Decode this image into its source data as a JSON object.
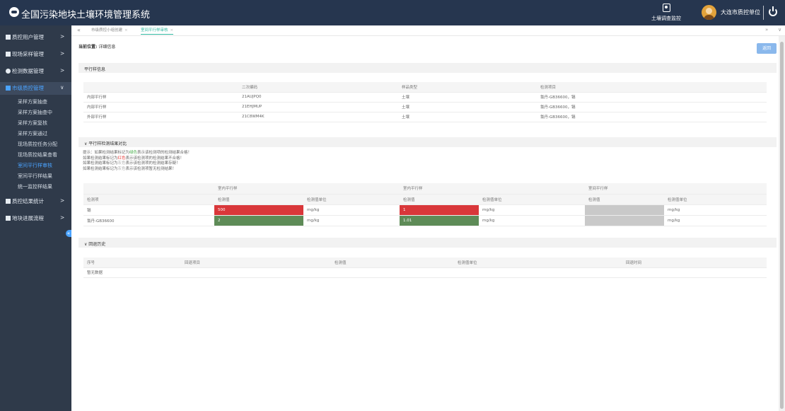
{
  "header": {
    "app_title": "全国污染地块土壤环境管理系统",
    "env_label": "土壤调查监控",
    "user_name": "大连市质控单位"
  },
  "sidebar": {
    "items": [
      {
        "label": "质控用户管理",
        "arrow": ">"
      },
      {
        "label": "现场采样管理",
        "arrow": ">"
      },
      {
        "label": "检测数据管理",
        "arrow": ">"
      },
      {
        "label": "市级质控管理",
        "arrow": "∨"
      },
      {
        "label": "质控结果统计",
        "arrow": ">"
      },
      {
        "label": "地块进展流程",
        "arrow": ">"
      }
    ],
    "sub_items": [
      "采样方案抽查",
      "采样方案抽查中",
      "采样方案复核",
      "采样方案通过",
      "现场质控任务分配",
      "现场质控结果查看",
      "室间平行样审核",
      "室间平行样结果",
      "统一监控样结果"
    ],
    "collapse": "«"
  },
  "tabs": {
    "prev": "«",
    "items": [
      {
        "label": "市级质控小组创建",
        "close": "×"
      },
      {
        "label": "室间平行样审核",
        "close": "×"
      }
    ],
    "next": "»",
    "dropdown": "∨"
  },
  "breadcrumb": {
    "label": "当前位置:",
    "value": "详细信息"
  },
  "back_button": "返回",
  "parallel_info": {
    "title": "平行样信息",
    "headers": [
      "",
      "二次编码",
      "样品类型",
      "检测项目"
    ],
    "rows": [
      [
        "内部平行样",
        "21AUJPQ0",
        "土壤",
        "氯丹-GB36600，镉"
      ],
      [
        "内部平行样",
        "21EHJMUP",
        "土壤",
        "氯丹-GB36600，镉"
      ],
      [
        "外部平行样",
        "21C8WM4K",
        "土壤",
        "氯丹-GB36600，镉"
      ]
    ]
  },
  "comparison": {
    "title": "∨ 平行样检测结果对比",
    "tips": {
      "line1_prefix": "提示：如果检测结果标记为",
      "line1_color": "绿色",
      "line1_suffix": "表示该检测项的检测结果合格！",
      "line2_prefix": "如果检测结果标记为",
      "line2_color": "红色",
      "line2_suffix": "表示该检测项的检测结果不合格！",
      "line3_prefix": "如果检测结果标记为",
      "line3_color": "灰色",
      "line3_suffix": "表示该检测项的检测结果存疑！",
      "line4_prefix": "如果检测结果标记为",
      "line4_color": "灰色",
      "line4_suffix": "表示该检测项暂无检测结果！"
    },
    "group_headers": [
      "",
      "室内平行样",
      "室内平行样",
      "室间平行样"
    ],
    "sub_headers": [
      "检测项",
      "检测值",
      "检测值单位",
      "检测值",
      "检测值单位",
      "检测值",
      "检测值单位"
    ],
    "rows": [
      {
        "item": "镉",
        "v1": "500",
        "u1": "mg/kg",
        "v2": "1",
        "u2": "mg/kg",
        "v3": "",
        "u3": "mg/kg",
        "status": [
          "red",
          "red",
          "gray"
        ]
      },
      {
        "item": "氯丹-GB36600",
        "v1": "2",
        "u1": "mg/kg",
        "v2": "1.01",
        "u2": "mg/kg",
        "v3": "",
        "u3": "mg/kg",
        "status": [
          "green",
          "green",
          "gray"
        ]
      }
    ]
  },
  "history": {
    "title": "∨ 回退历史",
    "headers": [
      "序号",
      "回退项目",
      "检测值",
      "检测值单位",
      "回退时间"
    ],
    "empty": "暂无数据"
  }
}
